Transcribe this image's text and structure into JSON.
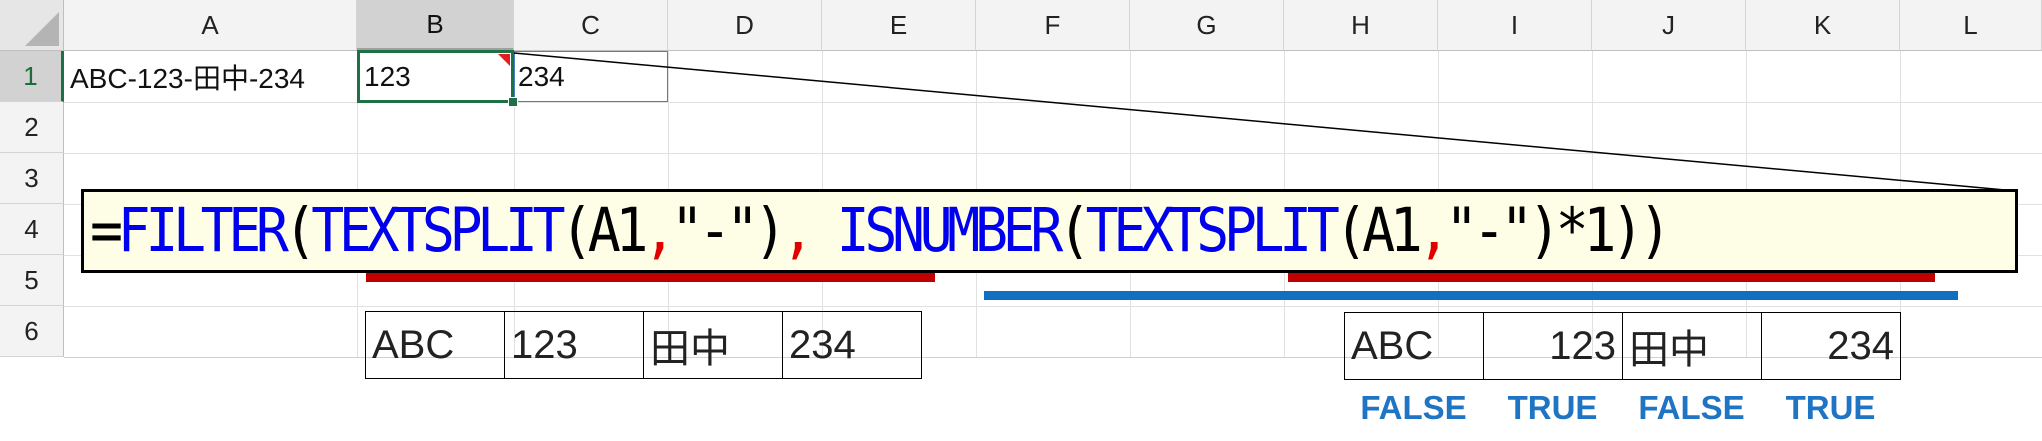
{
  "spreadsheet": {
    "columns": [
      "A",
      "B",
      "C",
      "D",
      "E",
      "F",
      "G",
      "H",
      "I",
      "J",
      "K",
      "L"
    ],
    "rows": [
      "1",
      "2",
      "3",
      "4",
      "5",
      "6"
    ],
    "selected_column": "B",
    "selected_row": "1",
    "cells": {
      "A1": "ABC-123-田中-234",
      "B1": "123",
      "C1": "234"
    }
  },
  "formula": {
    "tokens": [
      {
        "text": "=",
        "style": "fb"
      },
      {
        "text": "FILTER",
        "style": "fk"
      },
      {
        "text": "(",
        "style": "fb"
      },
      {
        "text": "TEXTSPLIT",
        "style": "fk"
      },
      {
        "text": "(A1",
        "style": "fb"
      },
      {
        "text": ",",
        "style": "fr"
      },
      {
        "text": "\"-\")",
        "style": "fb"
      },
      {
        "text": ", ",
        "style": "fr"
      },
      {
        "text": "ISNUMBER",
        "style": "fk"
      },
      {
        "text": "(",
        "style": "fb"
      },
      {
        "text": "TEXTSPLIT",
        "style": "fk"
      },
      {
        "text": "(A1",
        "style": "fb"
      },
      {
        "text": ",",
        "style": "fr"
      },
      {
        "text": "\"-\")*1))",
        "style": "fb"
      }
    ]
  },
  "textsplit_result": [
    "ABC",
    "123",
    "田中",
    "234"
  ],
  "isnumber_result": {
    "values": [
      "ABC",
      "123",
      "田中",
      "234"
    ],
    "flags": [
      "FALSE",
      "TRUE",
      "FALSE",
      "TRUE"
    ]
  },
  "colors": {
    "textsplit_underline": "#c00000",
    "isnumber_underline": "#1070c0",
    "keyword": "#0000ee",
    "separator": "#e00000",
    "flag": "#1f74c3",
    "selection": "#1e7145"
  }
}
